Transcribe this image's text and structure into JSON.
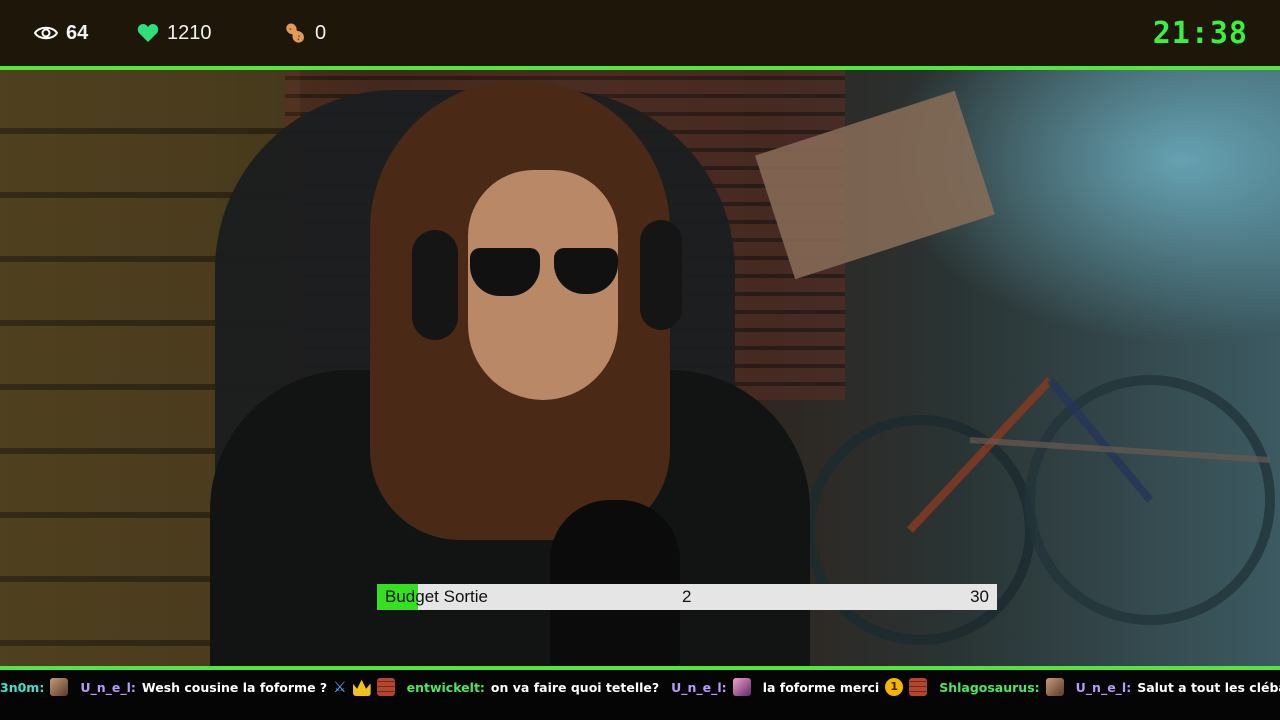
{
  "topbar": {
    "viewers": {
      "icon": "eye-icon",
      "value": "64"
    },
    "followers": {
      "icon": "heart-icon",
      "value": "1210"
    },
    "points": {
      "icon": "peanut-icon",
      "value": "0"
    },
    "clock": "21:38"
  },
  "colors": {
    "accent": "#52e83a",
    "clock": "#3df03d",
    "heart": "#2ee07a",
    "peanut": "#e39b58",
    "goal_fill": "#34e01f"
  },
  "goal": {
    "label": "Budget Sortie",
    "current": "2",
    "target": "30",
    "progress_fraction": 0.0667
  },
  "chat": [
    {
      "user": "3n0m:",
      "color": "cyan",
      "text": "",
      "emotes_after": [
        "face-emote"
      ]
    },
    {
      "user": "U_n_e_l:",
      "color": "purple",
      "text": "Wesh cousine la foforme ?",
      "emotes_after": [
        "sword-emote",
        "crown-emote",
        "brick-emote"
      ]
    },
    {
      "user": "entwickelt:",
      "color": "green",
      "text": "on va faire quoi tetelle?",
      "emotes_after": []
    },
    {
      "user": "U_n_e_l:",
      "color": "purple",
      "text": "",
      "emotes_after": [
        "pink-emote"
      ]
    },
    {
      "user": "",
      "color": "purple",
      "text": "la foforme merci",
      "emotes_after": [
        "coin-emote",
        "brick-emote"
      ]
    },
    {
      "user": "Shlagosaurus:",
      "color": "green",
      "text": "",
      "emotes_after": [
        "face-emote"
      ]
    },
    {
      "user": "U_n_e_l:",
      "color": "purple",
      "text": "Salut a tout les clébard aussi",
      "emotes_after": [
        "face-emote"
      ]
    }
  ],
  "coin_emote_text": "1"
}
